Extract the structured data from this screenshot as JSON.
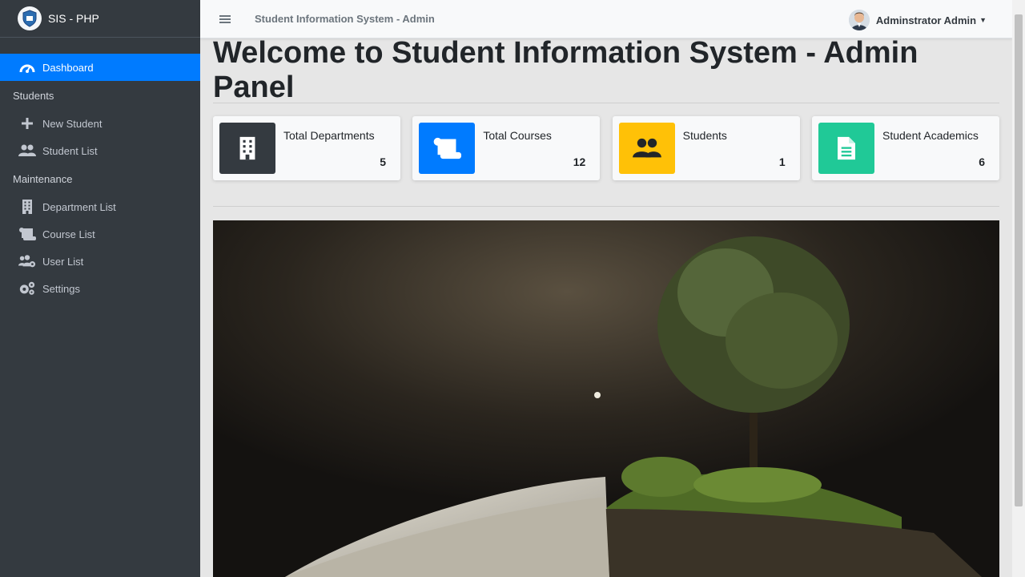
{
  "brand": {
    "name": "SIS - PHP"
  },
  "sidebar": {
    "items": [
      {
        "label": "Dashboard",
        "icon": "dashboard-icon"
      },
      {
        "header": "Students"
      },
      {
        "label": "New Student",
        "icon": "plus-icon"
      },
      {
        "label": "Student List",
        "icon": "users-icon"
      },
      {
        "header": "Maintenance"
      },
      {
        "label": "Department List",
        "icon": "building-icon"
      },
      {
        "label": "Course List",
        "icon": "scroll-icon"
      },
      {
        "label": "User List",
        "icon": "users-cog-icon"
      },
      {
        "label": "Settings",
        "icon": "cogs-icon"
      }
    ]
  },
  "topbar": {
    "title": "Student Information System - Admin",
    "user_name": "Adminstrator Admin"
  },
  "main": {
    "title": "Welcome to Student Information System - Admin Panel",
    "boxes": [
      {
        "label": "Total Departments",
        "value": "5",
        "color": "#343a40",
        "icon": "building-icon"
      },
      {
        "label": "Total Courses",
        "value": "12",
        "color": "#007bff",
        "icon": "scroll-icon"
      },
      {
        "label": "Students",
        "value": "1",
        "color": "#ffc107",
        "icon": "users-icon"
      },
      {
        "label": "Student Academics",
        "value": "6",
        "color": "#20c997",
        "icon": "file-icon"
      }
    ]
  },
  "colors": {
    "sidebar_bg": "#343a40",
    "accent": "#007bff"
  }
}
